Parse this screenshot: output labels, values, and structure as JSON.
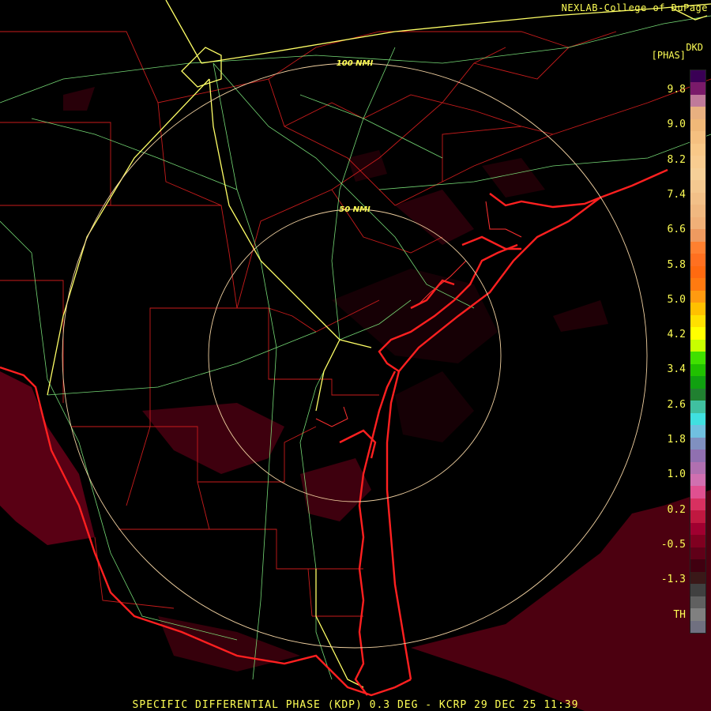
{
  "credit": "NEXLAB-College of DuPage",
  "product_code": "DKD",
  "units": "[PHAS]",
  "footer": "SPECIFIC DIFFERENTIAL PHASE (KDP) 0.3 DEG - KCRP 29 DEC 25 11:39",
  "range_rings": [
    "50 NMI",
    "100 NMI"
  ],
  "legend": {
    "ticks": [
      "9.8",
      "9.0",
      "8.2",
      "7.4",
      "6.6",
      "5.8",
      "5.0",
      "4.2",
      "3.4",
      "2.6",
      "1.8",
      "1.0",
      "0.2",
      "-0.5",
      "-1.3",
      "TH"
    ],
    "colors": [
      "#3a0055",
      "#7a1a6a",
      "#c07a9a",
      "#e8b080",
      "#f0b878",
      "#f5c080",
      "#f8c888",
      "#f8cc90",
      "#f6d098",
      "#f4c890",
      "#f2c088",
      "#f0b880",
      "#f0b078",
      "#ee9a60",
      "#ff8030",
      "#ff7020",
      "#ff6a10",
      "#ff7a10",
      "#ff9a10",
      "#ffc000",
      "#ffe000",
      "#ffff00",
      "#c8ff00",
      "#40e000",
      "#20c000",
      "#10a010",
      "#208030",
      "#40c0a0",
      "#40e0e0",
      "#70c0e0",
      "#8090c0",
      "#9070b0",
      "#b070b0",
      "#d070b0",
      "#e05090",
      "#d83060",
      "#c01840",
      "#a00030",
      "#800020",
      "#600018",
      "#400010",
      "#3a1818",
      "#404040",
      "#606060",
      "#808080",
      "#707080"
    ]
  },
  "map_colors": {
    "county_lines": "#c81c1c",
    "highways": "#8aff8a",
    "interstates": "#ffff66",
    "coastline": "#ff2020",
    "range_rings": "#f0d0a0",
    "echo": "#6a0018"
  }
}
